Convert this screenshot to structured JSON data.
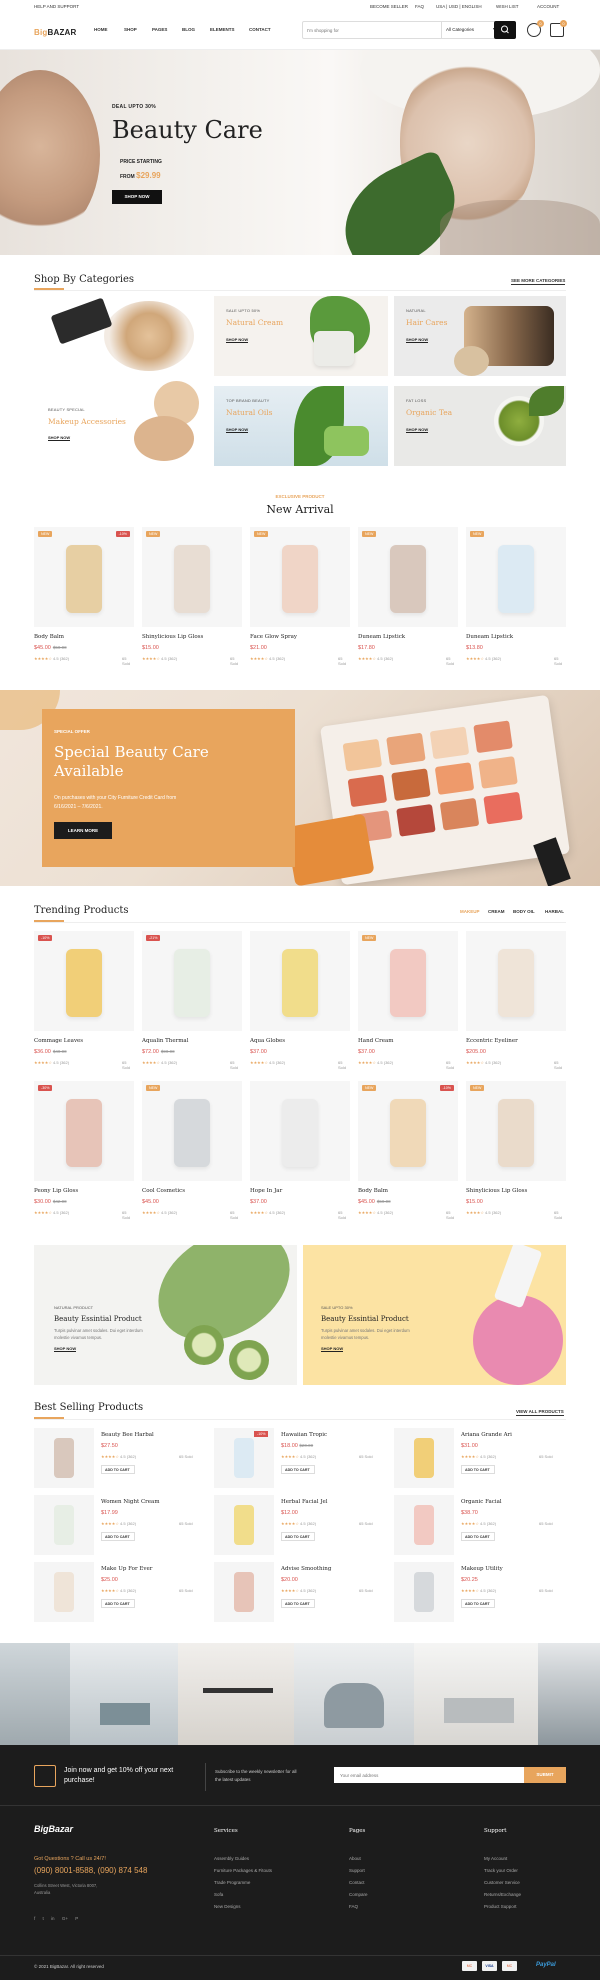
{
  "topbar": {
    "help": "HELP AND SUPPORT",
    "become_seller": "BECOME SELLER",
    "faq": "FAQ",
    "locale": "USA | USD | ENGLISH",
    "wishlist": "WISH LIST",
    "account": "ACCOUNT"
  },
  "header": {
    "logo_a": "Big",
    "logo_b": "BAZAR",
    "nav": [
      "HOME",
      "SHOP",
      "PAGES",
      "BLOG",
      "ELEMENTS",
      "CONTACT"
    ],
    "search_placeholder": "I'm shopping for",
    "category": "All Categories",
    "cart_count": "0",
    "wish_count": "0"
  },
  "hero": {
    "deal": "DEAL UPTO 30%",
    "title": "Beauty Care",
    "price_label": "PRICE STARTING",
    "from": "FROM",
    "price": "$29.99",
    "button": "SHOP NOW"
  },
  "categories": {
    "title": "Shop By Categories",
    "see_more": "SEE MORE CATEGORIES",
    "tiles": [
      {
        "sub": "BEAUTY SPECIAL",
        "title": "Makeup Accessories",
        "shop": "SHOP NOW"
      },
      {
        "sub": "SALE UPTO 50%",
        "title": "Natural Cream",
        "shop": "SHOP NOW"
      },
      {
        "sub": "NATURAL",
        "title": "Hair Cares",
        "shop": "SHOP NOW"
      },
      {
        "sub": "TOP BRAND BEAUTY",
        "title": "Natural Oils",
        "shop": "SHOP NOW"
      },
      {
        "sub": "FAT LOSS",
        "title": "Organic Tea",
        "shop": "SHOP NOW"
      }
    ]
  },
  "new_arrival": {
    "eyebrow": "EXCLUSIVE PRODUCT",
    "title": "New Arrival",
    "products": [
      {
        "name": "Body Balm",
        "price": "$45.00",
        "old": "$50.00",
        "badge1": "NEW",
        "badge2": "-10%",
        "rating": "4.5",
        "reviews": "(362)",
        "sold": "65 Sold"
      },
      {
        "name": "Shinylicious Lip Gloss",
        "price": "$15.00",
        "old": "",
        "badge1": "NEW",
        "badge2": "",
        "rating": "4.5",
        "reviews": "(362)",
        "sold": "65 Sold"
      },
      {
        "name": "Face Glow Spray",
        "price": "$21.00",
        "old": "",
        "badge1": "NEW",
        "badge2": "",
        "rating": "4.5",
        "reviews": "(362)",
        "sold": "65 Sold"
      },
      {
        "name": "Duneam Lipstick",
        "price": "$17.80",
        "old": "",
        "badge1": "NEW",
        "badge2": "",
        "rating": "4.5",
        "reviews": "(362)",
        "sold": "65 Sold"
      },
      {
        "name": "Duneam Lipstick",
        "price": "$13.80",
        "old": "",
        "badge1": "NEW",
        "badge2": "",
        "rating": "4.5",
        "reviews": "(362)",
        "sold": "65 Sold"
      }
    ]
  },
  "special": {
    "eyebrow": "SPECIAL OFFER",
    "title_line1": "Special Beauty Care",
    "title_line2": "Available",
    "text_line1": "On purchases with your City Furniture Credit Card from",
    "text_line2": "6/16/2021 – 7/6/2021.",
    "button": "LEARN MORE"
  },
  "trending": {
    "title": "Trending Products",
    "tabs": [
      "MAKEUP",
      "CREAM",
      "BODY OIL",
      "HARBAL"
    ],
    "products": [
      {
        "name": "Commage Leaves",
        "price": "$36.00",
        "old": "$40.00",
        "badge": "-10%",
        "badge_kind": "sale",
        "rating": "4.5",
        "reviews": "(362)",
        "sold": "65 Sold"
      },
      {
        "name": "Aqualin Thermal",
        "price": "$72.00",
        "old": "$90.00",
        "badge": "-21%",
        "badge_kind": "sale",
        "rating": "4.5",
        "reviews": "(362)",
        "sold": "65 Sold"
      },
      {
        "name": "Aqua Globes",
        "price": "$37.00",
        "old": "",
        "badge": "",
        "badge_kind": "",
        "rating": "4.5",
        "reviews": "(362)",
        "sold": "65 Sold"
      },
      {
        "name": "Hand Cream",
        "price": "$37.00",
        "old": "",
        "badge": "NEW",
        "badge_kind": "new",
        "rating": "4.5",
        "reviews": "(362)",
        "sold": "65 Sold"
      },
      {
        "name": "Eccentric Eyeliner",
        "price": "$205.00",
        "old": "",
        "badge": "",
        "badge_kind": "",
        "rating": "4.5",
        "reviews": "(362)",
        "sold": "65 Sold"
      },
      {
        "name": "Peony Lip Gloss",
        "price": "$30.00",
        "old": "$42.00",
        "badge": "-30%",
        "badge_kind": "sale",
        "rating": "4.5",
        "reviews": "(362)",
        "sold": "65 Sold"
      },
      {
        "name": "Cool Cosmetics",
        "price": "$45.00",
        "old": "",
        "badge": "NEW",
        "badge_kind": "new",
        "rating": "4.5",
        "reviews": "(362)",
        "sold": "65 Sold"
      },
      {
        "name": "Hope In Jar",
        "price": "$37.00",
        "old": "",
        "badge": "",
        "badge_kind": "",
        "rating": "4.5",
        "reviews": "(362)",
        "sold": "65 Sold"
      },
      {
        "name": "Body Balm",
        "price": "$45.00",
        "old": "$50.00",
        "badge": "NEW",
        "badge_kind": "new",
        "badge2": "-10%",
        "rating": "4.5",
        "reviews": "(362)",
        "sold": "65 Sold"
      },
      {
        "name": "Shinylicious Lip Gloss",
        "price": "$15.00",
        "old": "",
        "badge": "NEW",
        "badge_kind": "new",
        "rating": "4.5",
        "reviews": "(362)",
        "sold": "65 Sold"
      }
    ]
  },
  "banners": [
    {
      "sub": "NATURAL PRODUCT",
      "title": "Beauty Essintial Product",
      "text_line1": "Turpis pulvinar amet sodales. Dui eget interdum",
      "text_line2": "molestie vivamus tempus.",
      "shop": "SHOP NOW"
    },
    {
      "sub": "SALE UPTO 30%",
      "title": "Beauty Essintial Product",
      "text_line1": "Turpis pulvinar amet sodales. Dui eget interdum",
      "text_line2": "molestie vivamus tempus.",
      "shop": "SHOP NOW"
    }
  ],
  "best_selling": {
    "title": "Best Selling Products",
    "view_all": "VIEW ALL PRODUCTS",
    "add_to_cart": "ADD TO CART",
    "items": [
      {
        "name": "Beauty Bee Harbal",
        "price": "$27.50",
        "badge": "",
        "rating": "4.5",
        "reviews": "(362)",
        "sold": "65 Sold"
      },
      {
        "name": "Hawaiian Tropic",
        "price": "$18.00",
        "old": "$20.00",
        "badge": "-10%",
        "rating": "4.5",
        "reviews": "(362)",
        "sold": "65 Sold"
      },
      {
        "name": "Ariana Grande Ari",
        "price": "$31.00",
        "badge": "",
        "rating": "4.5",
        "reviews": "(362)",
        "sold": "65 Sold"
      },
      {
        "name": "Women Night Cream",
        "price": "$17.99",
        "badge": "",
        "rating": "4.5",
        "reviews": "(362)",
        "sold": "65 Sold"
      },
      {
        "name": "Herbal Facial Jel",
        "price": "$12.00",
        "badge": "",
        "rating": "4.5",
        "reviews": "(362)",
        "sold": "65 Sold"
      },
      {
        "name": "Organic Facial",
        "price": "$38.70",
        "badge": "",
        "rating": "4.5",
        "reviews": "(362)",
        "sold": "65 Sold"
      },
      {
        "name": "Make Up For Ever",
        "price": "$25.00",
        "badge": "",
        "rating": "4.5",
        "reviews": "(362)",
        "sold": "65 Sold"
      },
      {
        "name": "Advise Smoothing",
        "price": "$20.00",
        "badge": "",
        "rating": "4.5",
        "reviews": "(362)",
        "sold": "65 Sold"
      },
      {
        "name": "Makeup Utility",
        "price": "$20.25",
        "badge": "",
        "rating": "4.5",
        "reviews": "(362)",
        "sold": "65 Sold"
      }
    ]
  },
  "newsletter": {
    "join_line1": "Join now and get 10% off your next",
    "join_line2": "purchase!",
    "subscribe_line1": "Subscribe to the weekly newsletter for all",
    "subscribe_line2": "the latest updates",
    "placeholder": "Your email address",
    "button": "SUBMIT"
  },
  "footer": {
    "logo": "BigBazar",
    "questions": "Got Questions ? Call us 24/7!",
    "phone": "(090) 8001-8588, (090) 874 548",
    "address_line1": "Collins Street West, Victoria 8007,",
    "address_line2": "Australia",
    "social": [
      "f",
      "t",
      "in",
      "G+",
      "P"
    ],
    "columns": [
      {
        "title": "Services",
        "links": [
          "Assembly Guides",
          "Furniture Packages & Fitouts",
          "Trade Programme",
          "Sofa",
          "New Designs"
        ]
      },
      {
        "title": "Pages",
        "links": [
          "About",
          "Support",
          "Contact",
          "Compare",
          "FAQ"
        ]
      },
      {
        "title": "Support",
        "links": [
          "My Account",
          "Track your Order",
          "Customer Service",
          "Returns/Exchange",
          "Product Support"
        ]
      }
    ],
    "copyright": "© 2021 BigBazar. All right reserved",
    "payments": [
      "MC",
      "VISA",
      "MC",
      "PayPal"
    ]
  },
  "colors": {
    "accent": "#e8a55d",
    "sale": "#d9534f",
    "dark": "#1c1c1c"
  }
}
